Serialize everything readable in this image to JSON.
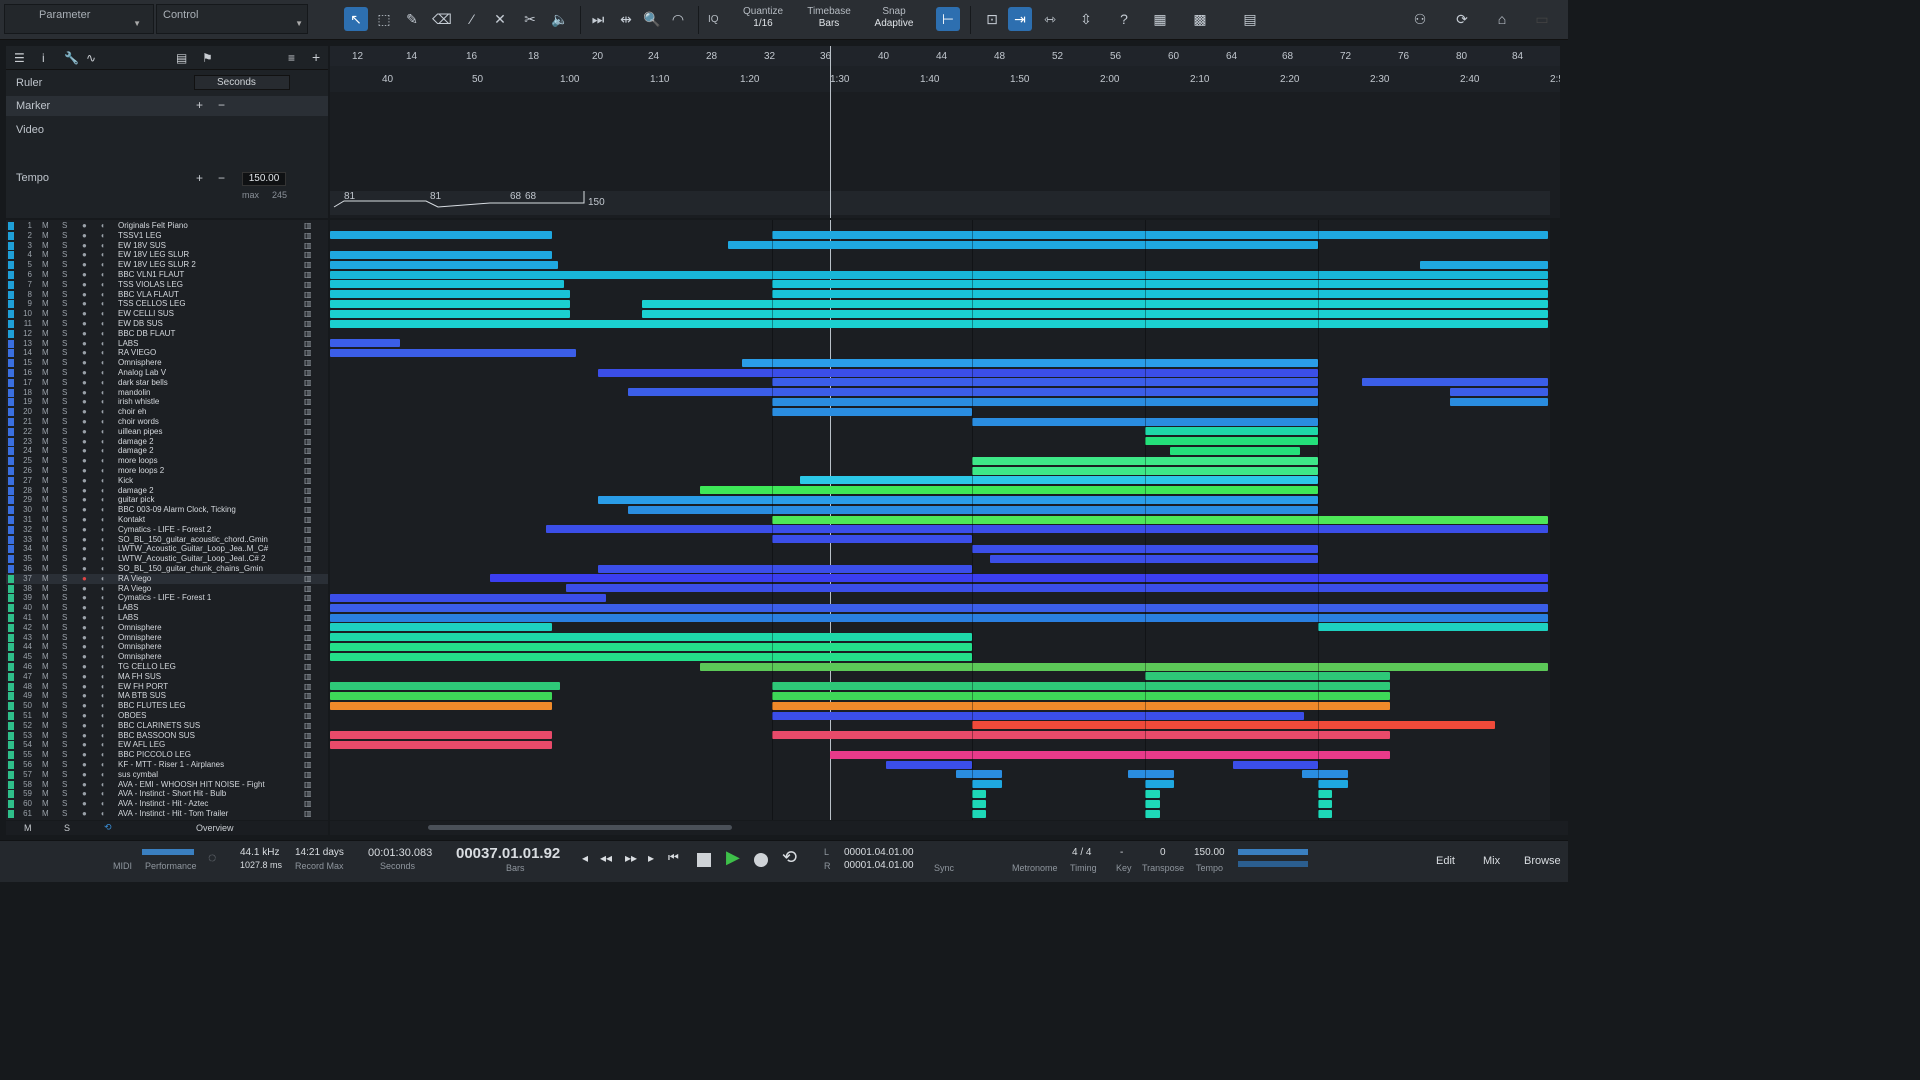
{
  "toolbar": {
    "parameter_label": "Parameter",
    "control_label": "Control",
    "quantize_label": "Quantize",
    "quantize_value": "1/16",
    "timebase_label": "Timebase",
    "timebase_value": "Bars",
    "snap_label": "Snap",
    "snap_value": "Adaptive",
    "iq_label": "IQ"
  },
  "left_panel": {
    "ruler_label": "Ruler",
    "ruler_value": "Seconds",
    "marker_label": "Marker",
    "video_label": "Video",
    "tempo_label": "Tempo",
    "tempo_value": "150.00",
    "max_label": "max",
    "max_value": "245"
  },
  "ruler": {
    "bars": [
      "12",
      "14",
      "16",
      "18",
      "20",
      "24",
      "28",
      "32",
      "36",
      "40",
      "44",
      "48",
      "52",
      "56",
      "60",
      "64",
      "68",
      "72",
      "76",
      "80",
      "84"
    ],
    "seconds": [
      "40",
      "50",
      "1:00",
      "1:10",
      "1:20",
      "1:30",
      "1:40",
      "1:50",
      "2:00",
      "2:10",
      "2:20",
      "2:30",
      "2:40",
      "2:5"
    ]
  },
  "tempo_points": [
    "81",
    "81",
    "68",
    "68",
    "150"
  ],
  "tracks": [
    {
      "n": "1",
      "name": "Originals Felt Piano"
    },
    {
      "n": "2",
      "name": "TSSV1 LEG"
    },
    {
      "n": "3",
      "name": "EW 18V SUS"
    },
    {
      "n": "4",
      "name": "EW 18V LEG SLUR"
    },
    {
      "n": "5",
      "name": "EW 18V LEG SLUR 2"
    },
    {
      "n": "6",
      "name": "BBC VLN1 FLAUT"
    },
    {
      "n": "7",
      "name": "TSS VIOLAS LEG"
    },
    {
      "n": "8",
      "name": "BBC VLA FLAUT"
    },
    {
      "n": "9",
      "name": "TSS CELLOS LEG"
    },
    {
      "n": "10",
      "name": "EW CELLI SUS"
    },
    {
      "n": "11",
      "name": "EW DB SUS"
    },
    {
      "n": "12",
      "name": "BBC DB FLAUT"
    },
    {
      "n": "13",
      "name": "LABS"
    },
    {
      "n": "14",
      "name": "RA VIEGO"
    },
    {
      "n": "15",
      "name": "Omnisphere"
    },
    {
      "n": "16",
      "name": "Analog Lab V"
    },
    {
      "n": "17",
      "name": "dark star bells"
    },
    {
      "n": "18",
      "name": "mandolin"
    },
    {
      "n": "19",
      "name": "irish whistle"
    },
    {
      "n": "20",
      "name": "choir eh"
    },
    {
      "n": "21",
      "name": "choir words"
    },
    {
      "n": "22",
      "name": "uillean pipes"
    },
    {
      "n": "23",
      "name": "damage 2"
    },
    {
      "n": "24",
      "name": "damage 2"
    },
    {
      "n": "25",
      "name": "more loops"
    },
    {
      "n": "26",
      "name": "more loops 2"
    },
    {
      "n": "27",
      "name": "Kick"
    },
    {
      "n": "28",
      "name": "damage 2"
    },
    {
      "n": "29",
      "name": "guitar pick"
    },
    {
      "n": "30",
      "name": "BBC 003-09 Alarm Clock, Ticking"
    },
    {
      "n": "31",
      "name": "Kontakt"
    },
    {
      "n": "32",
      "name": "Cymatics - LIFE - Forest 2"
    },
    {
      "n": "33",
      "name": "SO_BL_150_guitar_acoustic_chord..Gmin"
    },
    {
      "n": "34",
      "name": "LWTW_Acoustic_Guitar_Loop_Jea..M_C#"
    },
    {
      "n": "35",
      "name": "LWTW_Acoustic_Guitar_Loop_Jeal..C# 2"
    },
    {
      "n": "36",
      "name": "SO_BL_150_guitar_chunk_chains_Gmin"
    },
    {
      "n": "37",
      "name": "RA Viego"
    },
    {
      "n": "38",
      "name": "RA Viego"
    },
    {
      "n": "39",
      "name": "Cymatics - LIFE - Forest 1"
    },
    {
      "n": "40",
      "name": "LABS"
    },
    {
      "n": "41",
      "name": "LABS"
    },
    {
      "n": "42",
      "name": "Omnisphere"
    },
    {
      "n": "43",
      "name": "Omnisphere"
    },
    {
      "n": "44",
      "name": "Omnisphere"
    },
    {
      "n": "45",
      "name": "Omnisphere"
    },
    {
      "n": "46",
      "name": "TG CELLO LEG"
    },
    {
      "n": "47",
      "name": "MA FH SUS"
    },
    {
      "n": "48",
      "name": "EW FH PORT"
    },
    {
      "n": "49",
      "name": "MA BTB SUS"
    },
    {
      "n": "50",
      "name": "BBC FLUTES LEG"
    },
    {
      "n": "51",
      "name": "OBOES"
    },
    {
      "n": "52",
      "name": "BBC CLARINETS SUS"
    },
    {
      "n": "53",
      "name": "BBC BASSOON SUS"
    },
    {
      "n": "54",
      "name": "EW AFL LEG"
    },
    {
      "n": "55",
      "name": "BBC PICCOLO LEG"
    },
    {
      "n": "56",
      "name": "KF - MTT - Riser 1 - Airplanes"
    },
    {
      "n": "57",
      "name": "sus cymbal"
    },
    {
      "n": "58",
      "name": "AVA - EMI - WHOOSH HIT NOISE - Fight"
    },
    {
      "n": "59",
      "name": "AVA - Instinct - Short Hit - Bulb"
    },
    {
      "n": "60",
      "name": "AVA - Instinct - Hit - Aztec"
    },
    {
      "n": "61",
      "name": "AVA - Instinct - Hit - Tom Trailer"
    }
  ],
  "track_footer": {
    "m": "M",
    "s": "S",
    "overview": "Overview"
  },
  "transport": {
    "midi_label": "MIDI",
    "performance_label": "Performance",
    "sample_rate": "44.1 kHz",
    "latency": "1027.8 ms",
    "record_days": "14:21 days",
    "record_max_label": "Record Max",
    "time_seconds": "00:01:30.083",
    "seconds_label": "Seconds",
    "position": "00037.01.01.92",
    "bars_label": "Bars",
    "loop_l": "00001.04.01.00",
    "loop_r": "00001.04.01.00",
    "sync_label": "Sync",
    "metronome_label": "Metronome",
    "timing_label": "Timing",
    "signature": "4 / 4",
    "key_label": "Key",
    "key_value": "-",
    "transpose_label": "Transpose",
    "transpose_value": "0",
    "tempo_label": "Tempo",
    "tempo_value": "150.00",
    "edit_label": "Edit",
    "mix_label": "Mix",
    "browse_label": "Browse"
  }
}
